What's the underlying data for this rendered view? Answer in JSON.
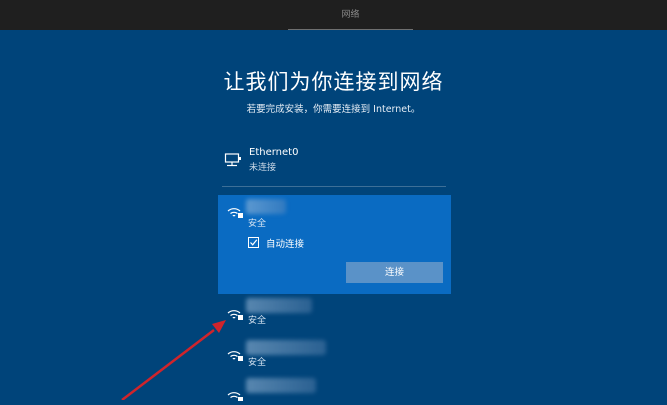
{
  "topbar": {
    "tab_label": "网络"
  },
  "page": {
    "title": "让我们为你连接到网络",
    "subtitle": "若要完成安装，你需要连接到 Internet。"
  },
  "ethernet": {
    "name": "Ethernet0",
    "status": "未连接",
    "icon": "ethernet-icon"
  },
  "wifi_selected": {
    "security": "安全",
    "auto_connect_label": "自动连接",
    "auto_connect_checked": true,
    "connect_button": "连接",
    "icon": "wifi-secure-icon"
  },
  "wifi_list": [
    {
      "security": "安全",
      "icon": "wifi-secure-icon"
    },
    {
      "security": "安全",
      "icon": "wifi-secure-icon"
    },
    {
      "security": "",
      "icon": "wifi-secure-icon"
    }
  ],
  "colors": {
    "background": "#00447a",
    "selected": "#0a6bc2",
    "button": "#5a92c8",
    "topbar": "#1f1f1f",
    "annotation_arrow": "#d0242b"
  }
}
